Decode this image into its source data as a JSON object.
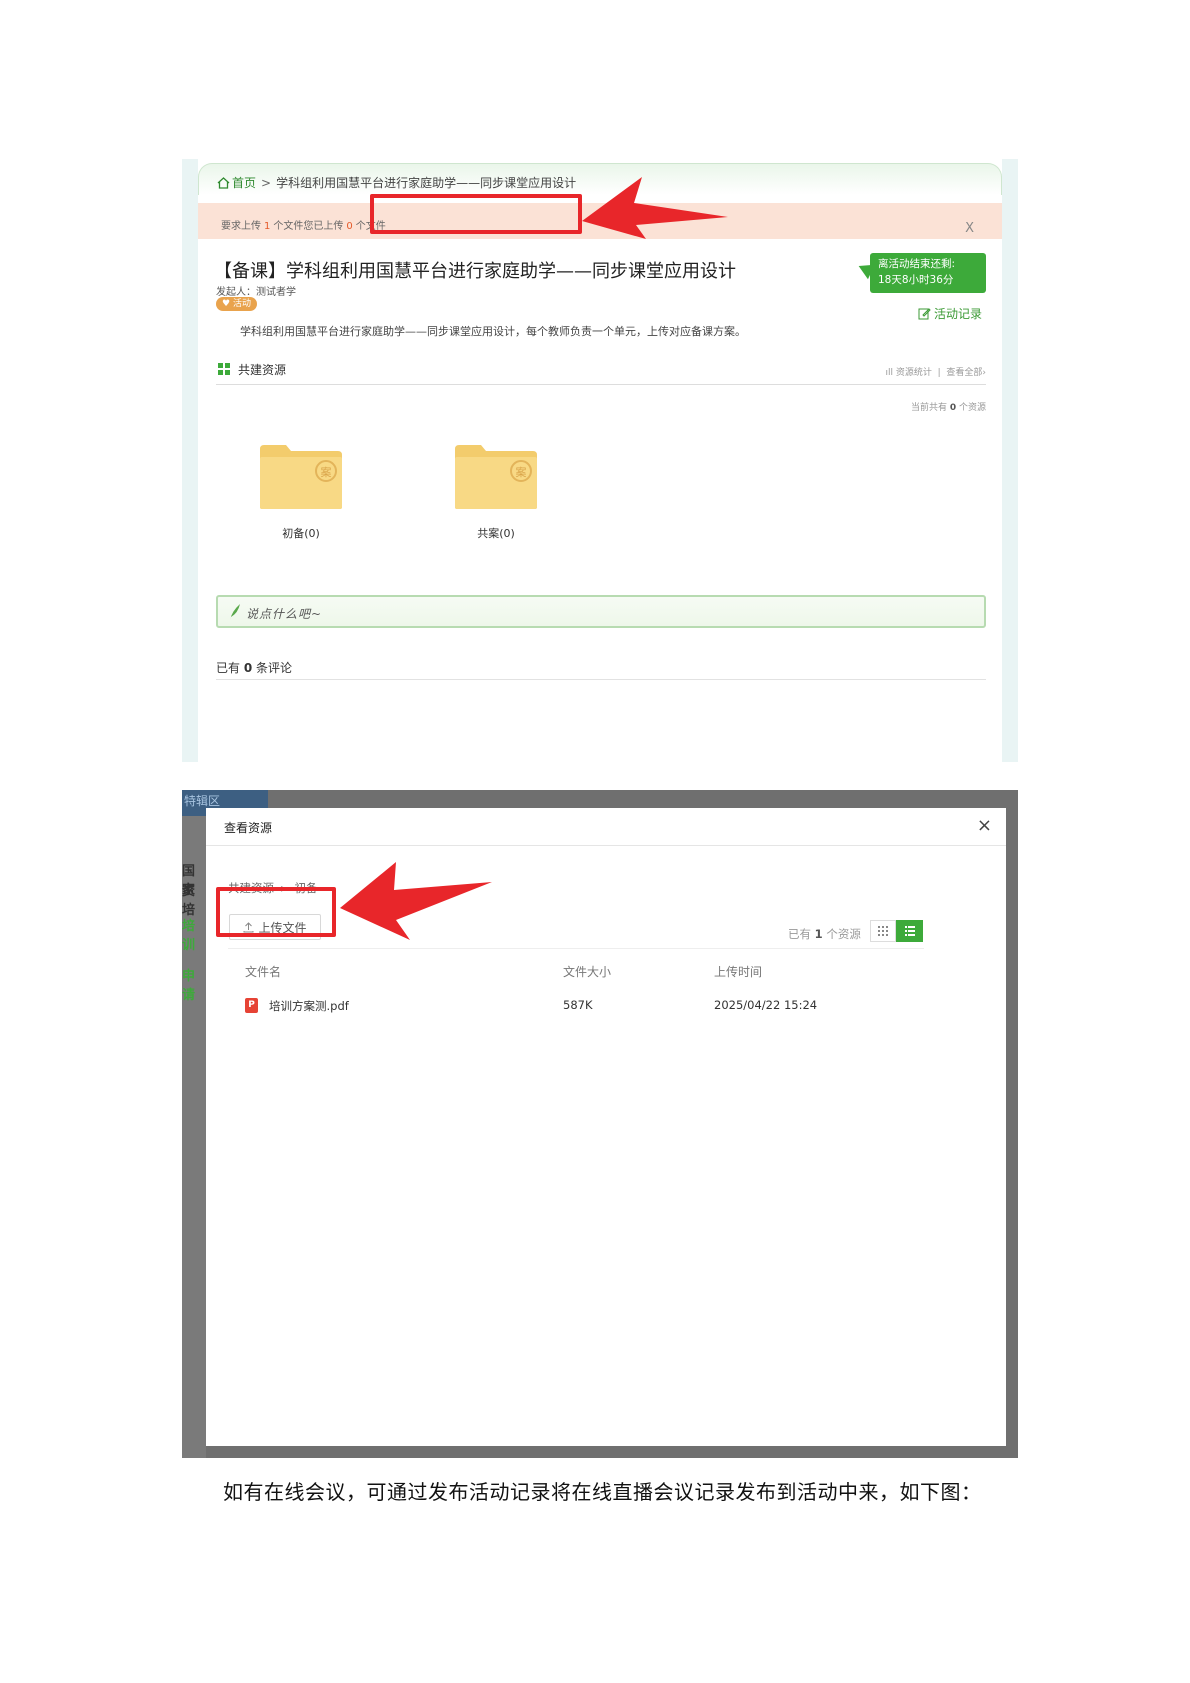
{
  "activity_page": {
    "breadcrumb": {
      "home": "首页",
      "separator": ">",
      "current": "学科组利用国慧平台进行家庭助学——同步课堂应用设计"
    },
    "upload_notice": {
      "prefix": "要求上传",
      "required_count": "1",
      "middle": "个文件您已上传",
      "uploaded_count": "0",
      "suffix": "个文件",
      "close": "X"
    },
    "title": "【备课】学科组利用国慧平台进行家庭助学——同步课堂应用设计",
    "initiator_label": "发起人：",
    "initiator_name": "测试者学",
    "tag": "活动",
    "countdown_line1": "离活动结束还剩:",
    "countdown_line2": "18天8小时36分",
    "record_link": "活动记录",
    "description": "学科组利用国慧平台进行家庭助学——同步课堂应用设计，每个教师负责一个单元，上传对应备课方案。",
    "section_title": "共建资源",
    "stats_link": "资源统计",
    "links_divider": "|",
    "view_all_link": "查看全部›",
    "current_prefix": "当前共有",
    "current_count": "0",
    "current_suffix": "个资源",
    "folders": [
      {
        "label": "初备(0)",
        "badge": "案"
      },
      {
        "label": "共案(0)",
        "badge": "案"
      }
    ],
    "comment_placeholder": "说点什么吧~",
    "comment_prefix": "已有",
    "comment_count": "0",
    "comment_suffix": "条评论"
  },
  "resource_modal": {
    "background_fragments": [
      "特辑区",
      "国家",
      "资培",
      "培训",
      "申请"
    ],
    "title": "查看资源",
    "close": "×",
    "breadcrumb_root": "共建资源",
    "breadcrumb_sep": ">",
    "breadcrumb_current": "初备",
    "upload_button": "上传文件",
    "count_prefix": "已有",
    "count_value": "1",
    "count_suffix": "个资源",
    "columns": [
      "文件名",
      "文件大小",
      "上传时间"
    ],
    "files": [
      {
        "name": "培训方案测.pdf",
        "size": "587K",
        "time": "2025/04/22 15:24",
        "icon": "P"
      }
    ]
  },
  "caption": "如有在线会议，可通过发布活动记录将在线直播会议记录发布到活动中来，如下图：",
  "colors": {
    "accent_green": "#3daa3a",
    "highlight_red": "#e8262a",
    "notice_bg": "#fbe2d6"
  }
}
